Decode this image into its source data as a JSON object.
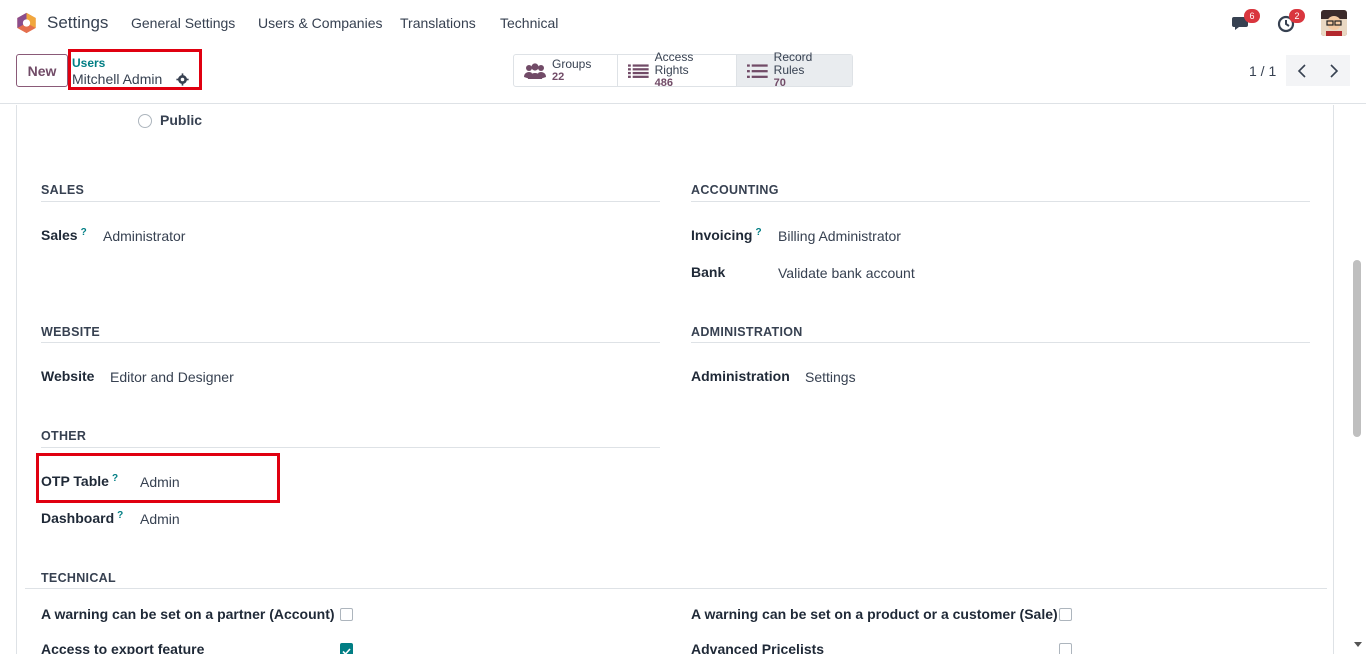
{
  "navbar": {
    "app_name": "Settings",
    "menu": [
      "General Settings",
      "Users & Companies",
      "Translations",
      "Technical"
    ],
    "messages_count": "6",
    "activities_count": "2"
  },
  "control_panel": {
    "new_label": "New",
    "breadcrumb_parent": "Users",
    "breadcrumb_current": "Mitchell Admin",
    "smart_buttons": [
      {
        "label": "Groups",
        "value": "22",
        "icon": "users-icon"
      },
      {
        "label": "Access Rights",
        "value": "486",
        "icon": "list-icon"
      },
      {
        "label": "Record Rules",
        "value": "70",
        "icon": "list-icon"
      }
    ],
    "pager": "1 / 1"
  },
  "form": {
    "user_type_option": "Public",
    "sections": {
      "sales": {
        "title": "SALES",
        "fields": [
          {
            "label": "Sales",
            "help": "?",
            "value": "Administrator"
          }
        ]
      },
      "accounting": {
        "title": "ACCOUNTING",
        "fields": [
          {
            "label": "Invoicing",
            "help": "?",
            "value": "Billing Administrator"
          },
          {
            "label": "Bank",
            "value": "Validate bank account"
          }
        ]
      },
      "website": {
        "title": "WEBSITE",
        "fields": [
          {
            "label": "Website",
            "value": "Editor and Designer"
          }
        ]
      },
      "administration": {
        "title": "ADMINISTRATION",
        "fields": [
          {
            "label": "Administration",
            "value": "Settings"
          }
        ]
      },
      "other": {
        "title": "OTHER",
        "fields": [
          {
            "label": "OTP Table",
            "help": "?",
            "value": "Admin"
          },
          {
            "label": "Dashboard",
            "help": "?",
            "value": "Admin"
          }
        ]
      },
      "technical": {
        "title": "TECHNICAL",
        "left": [
          {
            "label": "A warning can be set on a partner (Account)",
            "checked": false
          },
          {
            "label": "Access to export feature",
            "checked": true
          }
        ],
        "right": [
          {
            "label": "A warning can be set on a product or a customer (Sale)",
            "checked": false
          },
          {
            "label": "Advanced Pricelists",
            "checked": false
          }
        ]
      }
    }
  },
  "colors": {
    "brand": "#714B67",
    "teal": "#017e84",
    "highlight": "#e00010"
  }
}
